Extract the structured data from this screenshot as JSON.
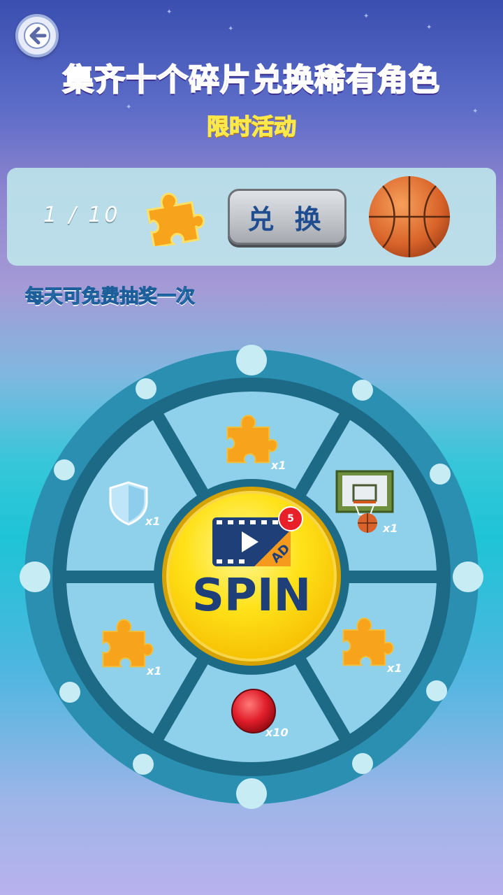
{
  "header": {
    "title": "集齐十个碎片兑换稀有角色",
    "subtitle": "限时活动"
  },
  "exchange_panel": {
    "progress": "1 / 10",
    "exchange_button": "兑 换",
    "reward_icon": "basketball-icon",
    "fragment_icon": "puzzle-piece-icon"
  },
  "daily_note": "每天可免费抽奖一次",
  "wheel": {
    "spin_label": "SPIN",
    "ad_badge_count": "5",
    "ad_icon": "video-ad-icon",
    "segments": [
      {
        "icon": "puzzle-piece-icon",
        "qty": "x1"
      },
      {
        "icon": "basketball-hoop-icon",
        "qty": "x1"
      },
      {
        "icon": "puzzle-piece-icon",
        "qty": "x1"
      },
      {
        "icon": "red-ball-icon",
        "qty": "x10"
      },
      {
        "icon": "puzzle-piece-icon",
        "qty": "x1"
      },
      {
        "icon": "shield-icon",
        "qty": "x1"
      }
    ]
  },
  "colors": {
    "wheel_outer": "#2a8fb0",
    "wheel_ring": "#1d6a86",
    "segment": "#8fd0ea",
    "spin_button": "#ffd800",
    "puzzle": "#f7a41c"
  }
}
